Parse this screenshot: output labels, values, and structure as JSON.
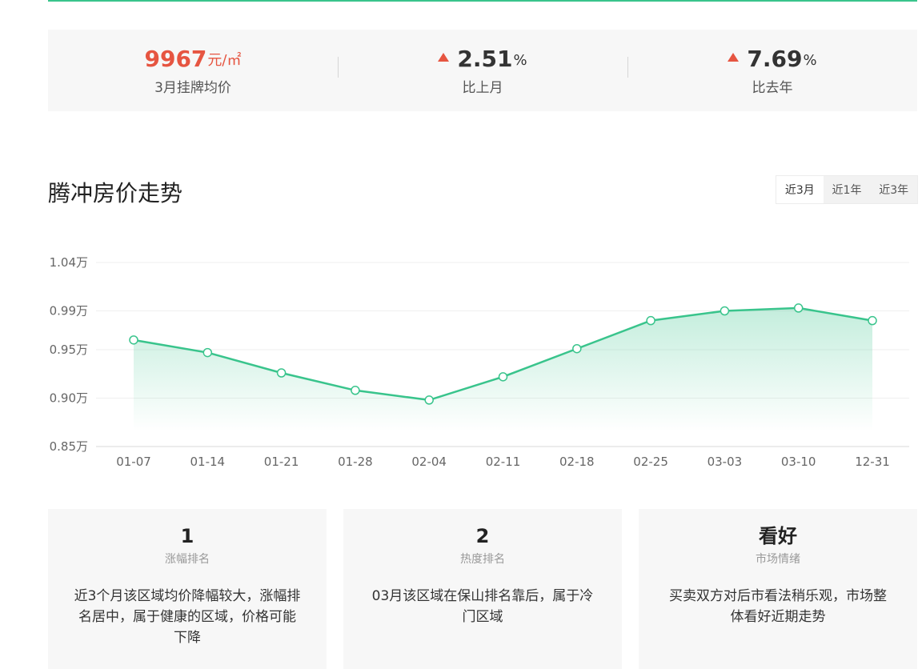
{
  "summary": {
    "avg_price": {
      "value": "9967",
      "unit": "元/㎡",
      "label": "3月挂牌均价"
    },
    "mom": {
      "value": "2.51",
      "unit": "%",
      "label": "比上月",
      "direction": "up"
    },
    "yoy": {
      "value": "7.69",
      "unit": "%",
      "label": "比去年",
      "direction": "up"
    }
  },
  "title": "腾冲房价走势",
  "range_tabs": [
    {
      "label": "近3月",
      "active": true
    },
    {
      "label": "近1年",
      "active": false
    },
    {
      "label": "近3年",
      "active": false
    }
  ],
  "colors": {
    "accent": "#39c48c",
    "up": "#e65541"
  },
  "chart_data": {
    "type": "area",
    "categories": [
      "01-07",
      "01-14",
      "01-21",
      "01-28",
      "02-04",
      "02-11",
      "02-18",
      "02-25",
      "03-03",
      "03-10",
      "12-31"
    ],
    "values": [
      0.96,
      0.947,
      0.926,
      0.908,
      0.898,
      0.922,
      0.951,
      0.98,
      0.99,
      0.993,
      0.98
    ],
    "y_ticks": [
      0.85,
      0.9,
      0.95,
      0.99,
      1.04
    ],
    "y_tick_labels": [
      "0.85万",
      "0.90万",
      "0.95万",
      "0.99万",
      "1.04万"
    ],
    "ylim": [
      0.85,
      1.04
    ],
    "grid": true
  },
  "cards": [
    {
      "value": "1",
      "label": "涨幅排名",
      "desc": "近3个月该区域均价降幅较大，涨幅排名居中，属于健康的区域，价格可能下降"
    },
    {
      "value": "2",
      "label": "热度排名",
      "desc": "03月该区域在保山排名靠后，属于冷门区域"
    },
    {
      "value": "看好",
      "label": "市场情绪",
      "desc": "买卖双方对后市看法稍乐观，市场整体看好近期走势"
    }
  ]
}
